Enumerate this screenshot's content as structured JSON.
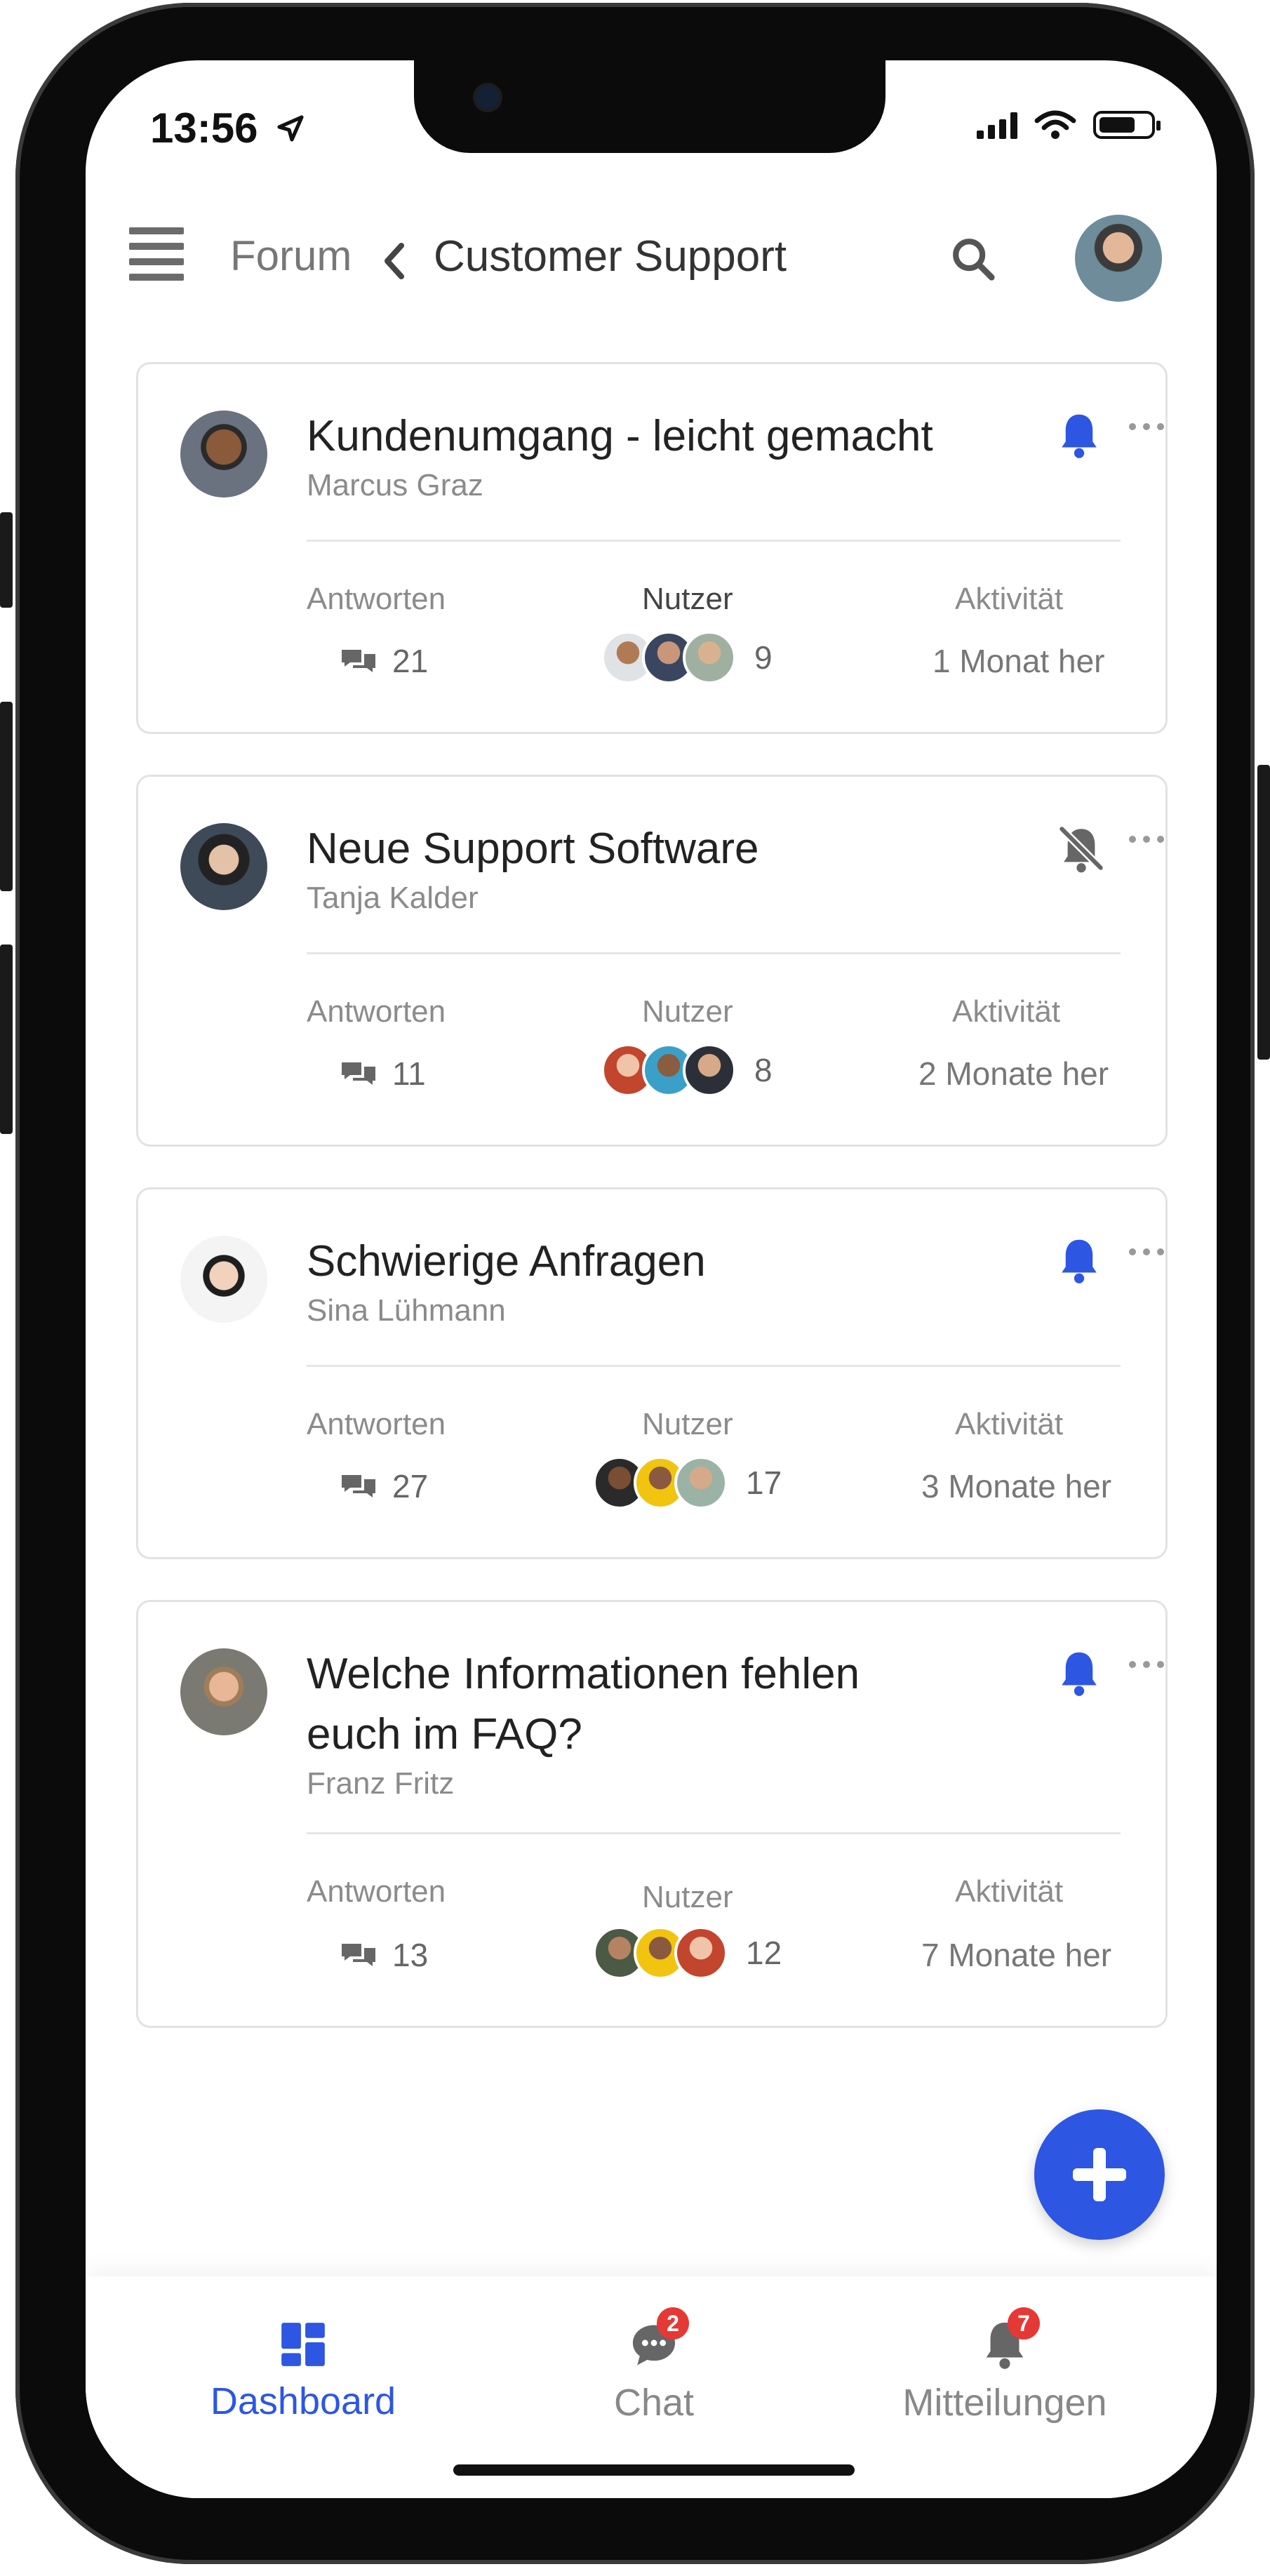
{
  "status_bar": {
    "time": "13:56"
  },
  "header": {
    "breadcrumb_parent": "Forum",
    "breadcrumb_current": "Customer Support"
  },
  "labels": {
    "replies": "Antworten",
    "users": "Nutzer",
    "activity": "Aktivität"
  },
  "accent_color": "#2d56e3",
  "threads": [
    {
      "title": "Kundenumgang - leicht gemacht",
      "author": "Marcus Graz",
      "replies": "21",
      "users_count": "9",
      "activity": "1 Monat her",
      "notifications": "on"
    },
    {
      "title": "Neue Support Software",
      "author": "Tanja Kalder",
      "replies": "11",
      "users_count": "8",
      "activity": "2 Monate her",
      "notifications": "off"
    },
    {
      "title": "Schwierige Anfragen",
      "author": "Sina Lühmann",
      "replies": "27",
      "users_count": "17",
      "activity": "3 Monate her",
      "notifications": "on"
    },
    {
      "title": "Welche Informationen fehlen euch im FAQ?",
      "author": "Franz Fritz",
      "replies": "13",
      "users_count": "12",
      "activity": "7 Monate her",
      "notifications": "on"
    }
  ],
  "tabbar": {
    "dashboard": "Dashboard",
    "chat": "Chat",
    "chat_badge": "2",
    "notifications": "Mitteilungen",
    "notifications_badge": "7"
  }
}
